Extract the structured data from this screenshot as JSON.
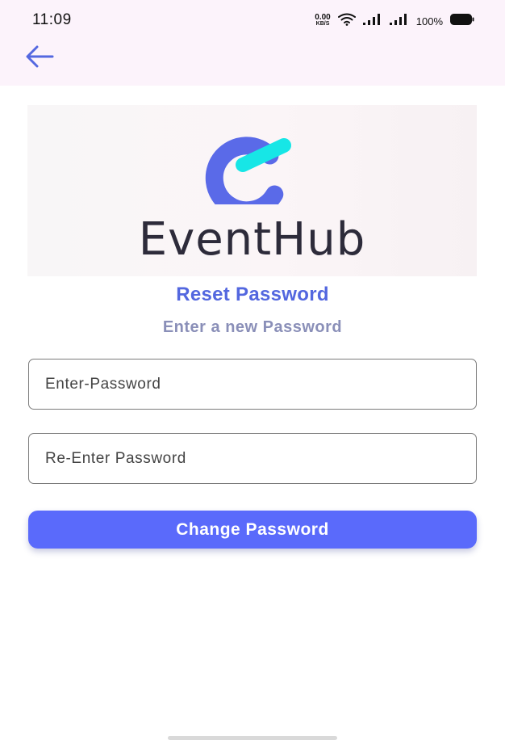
{
  "status_bar": {
    "time": "11:09",
    "net_speed_value": "0.00",
    "net_speed_unit": "KB/S",
    "battery": "100%",
    "icons": [
      "wifi-icon",
      "signal-icon",
      "signal-icon",
      "battery-icon"
    ]
  },
  "nav": {
    "back_icon": "arrow-left-icon"
  },
  "logo": {
    "text": "EventHub",
    "colors": {
      "ring": "#5a6ae8",
      "accent": "#17e6e6",
      "wordmark": "#2d2b3a"
    }
  },
  "page": {
    "title": "Reset Password",
    "subtitle": "Enter a new Password"
  },
  "form": {
    "password": {
      "placeholder": "Enter-Password",
      "value": ""
    },
    "confirm_password": {
      "placeholder": "Re-Enter Password",
      "value": ""
    },
    "submit_label": "Change Password"
  },
  "theme": {
    "top_bar_bg": "#fcf3fb",
    "primary": "#5a6afb",
    "title": "#5367df",
    "subtitle": "#8a8fb8",
    "back_arrow": "#5468e0"
  }
}
